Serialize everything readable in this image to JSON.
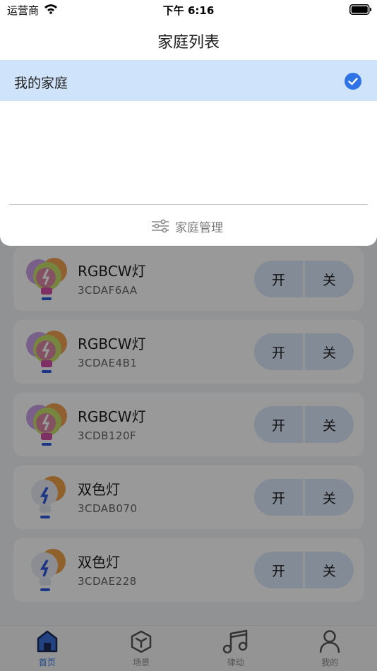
{
  "status_bar": {
    "carrier": "运营商",
    "time": "下午 6:16"
  },
  "sheet": {
    "title": "家庭列表",
    "homes": [
      {
        "label": "我的家庭",
        "selected": true
      }
    ],
    "manage_label": "家庭管理"
  },
  "devices": [
    {
      "name": "RGBCW灯",
      "id": "3CDAF6AA",
      "type": "rgb",
      "on_label": "开",
      "off_label": "关"
    },
    {
      "name": "RGBCW灯",
      "id": "3CDAE4B1",
      "type": "rgb",
      "on_label": "开",
      "off_label": "关"
    },
    {
      "name": "RGBCW灯",
      "id": "3CDB120F",
      "type": "rgb",
      "on_label": "开",
      "off_label": "关"
    },
    {
      "name": "双色灯",
      "id": "3CDAB070",
      "type": "dual",
      "on_label": "开",
      "off_label": "关"
    },
    {
      "name": "双色灯",
      "id": "3CDAE228",
      "type": "dual",
      "on_label": "开",
      "off_label": "关"
    }
  ],
  "tabs": [
    {
      "label": "首页",
      "icon": "home-icon",
      "active": true
    },
    {
      "label": "场景",
      "icon": "scene-cube-icon",
      "active": false
    },
    {
      "label": "律动",
      "icon": "music-note-icon",
      "active": false
    },
    {
      "label": "我的",
      "icon": "person-icon",
      "active": false
    }
  ],
  "colors": {
    "accent": "#2f74e6",
    "selected_row": "#cfe3fb",
    "switch_bg": "#dbe8fb"
  }
}
